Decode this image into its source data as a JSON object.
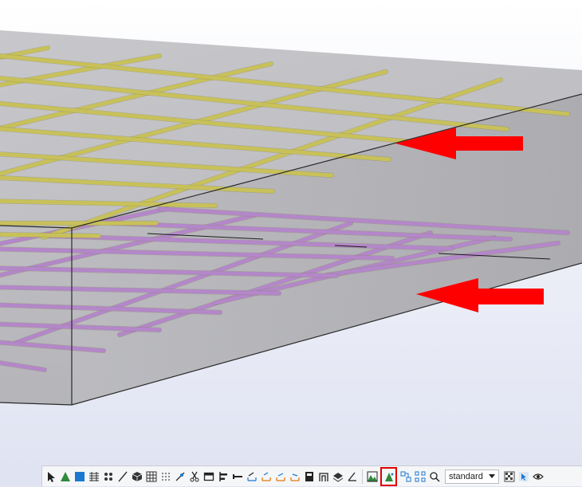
{
  "colors": {
    "top_rebar": "#c8c15a",
    "bottom_rebar": "#b387c9",
    "slab_top": "#bdbdc1",
    "slab_front": "#b8b8bc",
    "slab_side": "#a9a9ad",
    "arrow": "#ff0000",
    "highlight_box": "#e00000"
  },
  "toolbar": {
    "view_select": "standard",
    "buttons": [
      {
        "name": "select-pointer-icon"
      },
      {
        "name": "green-triangle-icon"
      },
      {
        "name": "blue-square-icon"
      },
      {
        "name": "grid-lines-icon"
      },
      {
        "name": "points-icon"
      },
      {
        "name": "line-icon"
      },
      {
        "name": "cube-icon"
      },
      {
        "name": "grid-icon"
      },
      {
        "name": "dots-grid-icon"
      },
      {
        "name": "snap-icon"
      },
      {
        "name": "scissors-icon"
      },
      {
        "name": "frame-icon"
      },
      {
        "name": "align-icon"
      },
      {
        "name": "beam-icon"
      },
      {
        "name": "dimension-icon"
      },
      {
        "name": "snap-orange-1-icon"
      },
      {
        "name": "snap-orange-2-icon"
      },
      {
        "name": "snap-orange-3-icon"
      },
      {
        "name": "panel-icon"
      },
      {
        "name": "portal-icon"
      },
      {
        "name": "layers-icon"
      },
      {
        "name": "angle-icon"
      }
    ],
    "buttons2": [
      {
        "name": "green-mountain-icon"
      },
      {
        "name": "green-rebar-display-icon",
        "highlighted": true
      },
      {
        "name": "component-icon"
      },
      {
        "name": "group-icon"
      },
      {
        "name": "magnet-icon"
      }
    ],
    "buttons3": [
      {
        "name": "pattern-icon"
      },
      {
        "name": "cursor-select-icon"
      },
      {
        "name": "eye-icon"
      }
    ]
  }
}
